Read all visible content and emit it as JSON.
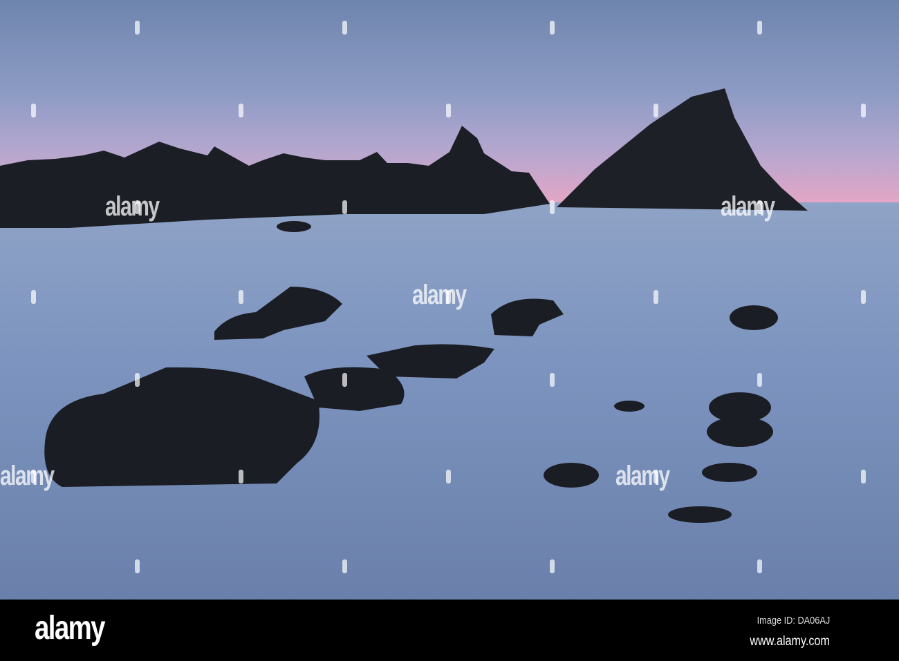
{
  "watermark": {
    "text": "alamy"
  },
  "footer": {
    "logo": "alamy",
    "image_id": "Image ID: DA06AJ",
    "website": "www.alamy.com"
  }
}
